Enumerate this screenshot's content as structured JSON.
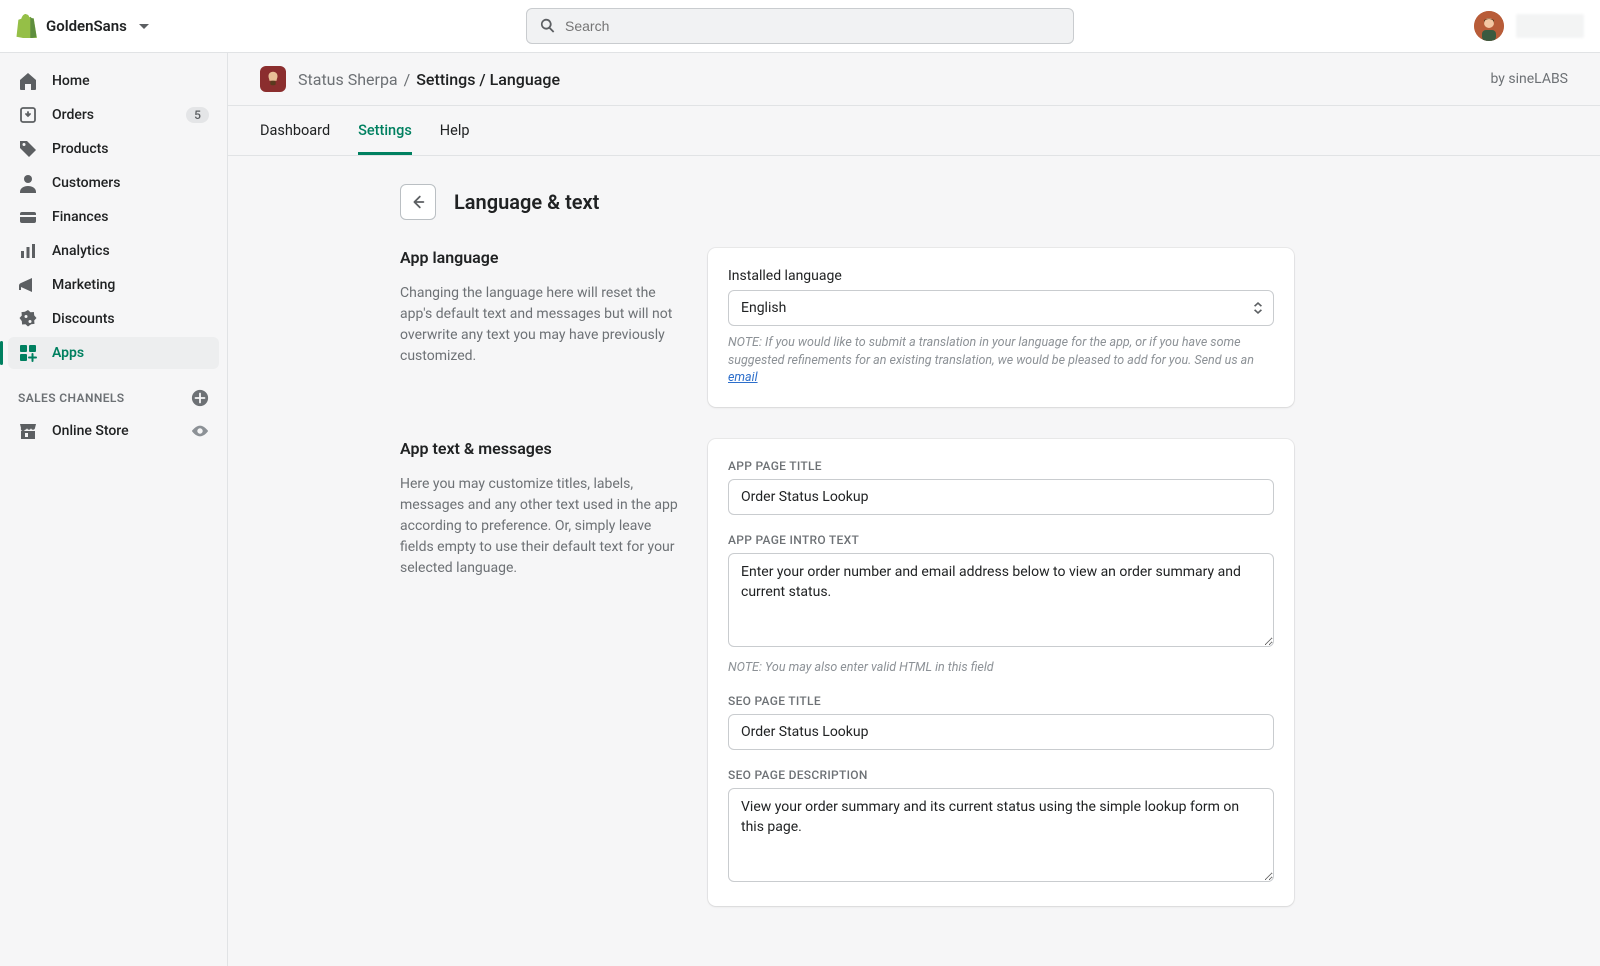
{
  "topbar": {
    "store_name": "GoldenSans",
    "search_placeholder": "Search"
  },
  "sidebar": {
    "items": [
      {
        "label": "Home"
      },
      {
        "label": "Orders",
        "badge": "5"
      },
      {
        "label": "Products"
      },
      {
        "label": "Customers"
      },
      {
        "label": "Finances"
      },
      {
        "label": "Analytics"
      },
      {
        "label": "Marketing"
      },
      {
        "label": "Discounts"
      },
      {
        "label": "Apps"
      }
    ],
    "section_title": "SALES CHANNELS",
    "channel": {
      "label": "Online Store"
    }
  },
  "app_header": {
    "app_name": "Status Sherpa",
    "breadcrumb": "Settings / Language",
    "by_line": "by sineLABS"
  },
  "tabs": [
    {
      "label": "Dashboard"
    },
    {
      "label": "Settings"
    },
    {
      "label": "Help"
    }
  ],
  "page": {
    "title": "Language & text",
    "section1": {
      "title": "App language",
      "desc": "Changing the language here will reset the app's default text and messages but will not overwrite any text you may have previously customized.",
      "language_label": "Installed language",
      "language_value": "English",
      "note_prefix": "NOTE: If you would like to submit a translation in your language for the app, or if you have some suggested refinements for an existing translation, we would be pleased to add for you. Send us an ",
      "note_link": "email"
    },
    "section2": {
      "title": "App text & messages",
      "desc": "Here you may customize titles, labels, messages and any other text used in the app according to preference. Or, simply leave fields empty to use their default text for your selected language.",
      "field1_label": "APP PAGE TITLE",
      "field1_value": "Order Status Lookup",
      "field2_label": "APP PAGE INTRO TEXT",
      "field2_value": "Enter your order number and email address below to view an order summary and current status.",
      "field2_note": "NOTE: You may also enter valid HTML in this field",
      "field3_label": "SEO PAGE TITLE",
      "field3_value": "Order Status Lookup",
      "field4_label": "SEO PAGE DESCRIPTION",
      "field4_value": "View your order summary and its current status using the simple lookup form on this page."
    }
  }
}
